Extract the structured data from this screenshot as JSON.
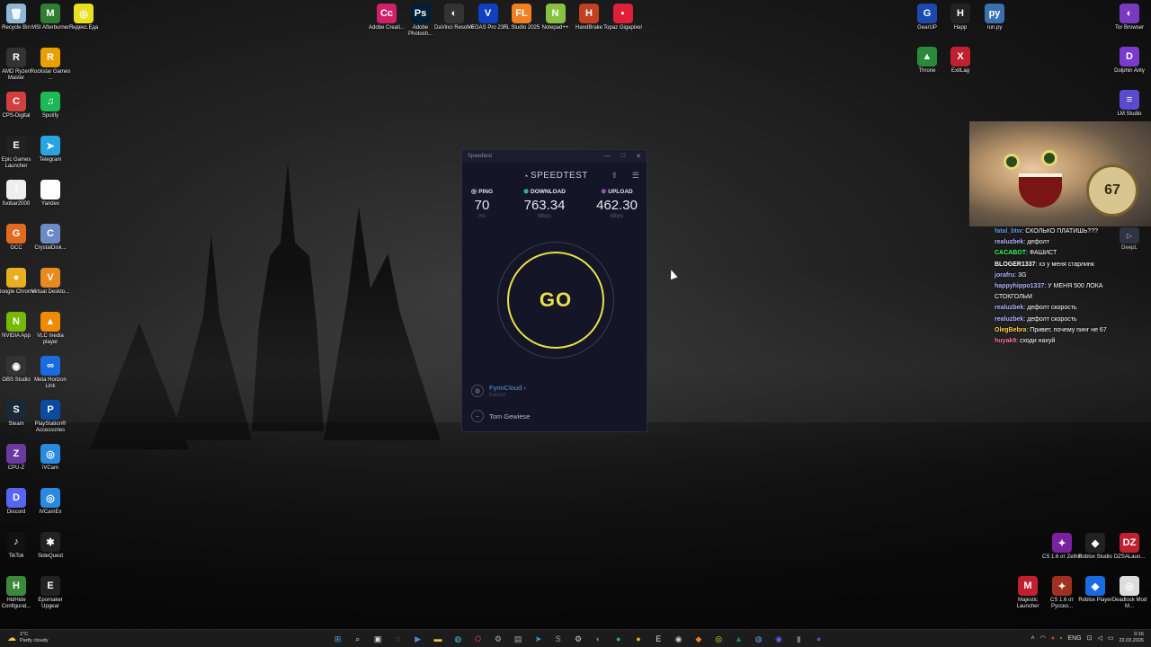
{
  "desktop": {
    "left_column_1": [
      {
        "label": "Recycle Bin",
        "icon": "recycle-bin-icon",
        "color": "#8fb8d8",
        "glyph": "🗑"
      },
      {
        "label": "AMD Ryzen Master",
        "icon": "amd-icon",
        "color": "#333",
        "glyph": "R"
      },
      {
        "label": "CPS-Digital",
        "icon": "cps-icon",
        "color": "#d04040",
        "glyph": "C"
      },
      {
        "label": "Epic Games Launcher",
        "icon": "epic-games-icon",
        "color": "#222",
        "glyph": "E"
      },
      {
        "label": "foobar2000",
        "icon": "foobar-icon",
        "color": "#eee",
        "glyph": "f"
      },
      {
        "label": "GCC",
        "icon": "gcc-icon",
        "color": "#e06a20",
        "glyph": "G"
      },
      {
        "label": "Google Chrome",
        "icon": "chrome-icon",
        "color": "#e8b020",
        "glyph": "●"
      },
      {
        "label": "NVIDIA App",
        "icon": "nvidia-icon",
        "color": "#76b900",
        "glyph": "N"
      },
      {
        "label": "OBS Studio",
        "icon": "obs-icon",
        "color": "#333",
        "glyph": "◉"
      },
      {
        "label": "Steam",
        "icon": "steam-icon",
        "color": "#1b2838",
        "glyph": "S"
      },
      {
        "label": "CPU-Z",
        "icon": "cpuz-icon",
        "color": "#6a3aa0",
        "glyph": "Z"
      },
      {
        "label": "Discord",
        "icon": "discord-icon",
        "color": "#5865f2",
        "glyph": "D"
      },
      {
        "label": "TikTok",
        "icon": "tiktok-icon",
        "color": "#111",
        "glyph": "♪"
      },
      {
        "label": "HidHide Configurat...",
        "icon": "hidhide-icon",
        "color": "#3a8a3a",
        "glyph": "H"
      }
    ],
    "left_column_2": [
      {
        "label": "MSI Afterburner",
        "icon": "msi-afterburner-icon",
        "color": "#2e7d32",
        "glyph": "M"
      },
      {
        "label": "Rockstar Games ...",
        "icon": "rockstar-icon",
        "color": "#e8a000",
        "glyph": "R"
      },
      {
        "label": "Spotify",
        "icon": "spotify-icon",
        "color": "#1db954",
        "glyph": "♫"
      },
      {
        "label": "Telegram",
        "icon": "telegram-icon",
        "color": "#2aa3e0",
        "glyph": "➤"
      },
      {
        "label": "Yandex",
        "icon": "yandex-icon",
        "color": "#fff",
        "glyph": "Y"
      },
      {
        "label": "CrystalDisk...",
        "icon": "crystaldisk-icon",
        "color": "#6a8ac8",
        "glyph": "C"
      },
      {
        "label": "Virtual Deskto...",
        "icon": "virtual-desktop-icon",
        "color": "#e88a20",
        "glyph": "V"
      },
      {
        "label": "VLC media player",
        "icon": "vlc-icon",
        "color": "#f08a00",
        "glyph": "▲"
      },
      {
        "label": "Meta Horizon Link",
        "icon": "meta-icon",
        "color": "#1a6ae0",
        "glyph": "∞"
      },
      {
        "label": "PlayStation® Accessories",
        "icon": "playstation-icon",
        "color": "#0a4aa0",
        "glyph": "P"
      },
      {
        "label": "iVCam",
        "icon": "ivcam-icon",
        "color": "#2a8ae0",
        "glyph": "◎"
      },
      {
        "label": "iVCamEx",
        "icon": "ivcamex-icon",
        "color": "#2a8ae0",
        "glyph": "◎"
      },
      {
        "label": "SideQuest",
        "icon": "sidequest-icon",
        "color": "#222",
        "glyph": "✱"
      },
      {
        "label": "Epomaker Upgear",
        "icon": "epomaker-icon",
        "color": "#222",
        "glyph": "E"
      }
    ],
    "third_item": {
      "label": "Яндекс.Еда",
      "icon": "yandex-eda-icon",
      "color": "#e8e020",
      "glyph": "◎"
    },
    "top_row": [
      {
        "label": "Adobe Creati...",
        "icon": "adobe-cc-icon",
        "color": "#d0206a",
        "glyph": "Cc"
      },
      {
        "label": "Adobe Photosh...",
        "icon": "photoshop-icon",
        "color": "#001e36",
        "glyph": "Ps"
      },
      {
        "label": "DaVinci Resolve",
        "icon": "davinci-icon",
        "color": "#333",
        "glyph": "◐"
      },
      {
        "label": "VEGAS Pro 23.0",
        "icon": "vegas-icon",
        "color": "#1040c0",
        "glyph": "V"
      },
      {
        "label": "FL Studio 2025",
        "icon": "fl-studio-icon",
        "color": "#f08020",
        "glyph": "FL"
      },
      {
        "label": "Notepad++",
        "icon": "notepadpp-icon",
        "color": "#8ac040",
        "glyph": "N"
      },
      {
        "label": "HandBrake",
        "icon": "handbrake-icon",
        "color": "#c04020",
        "glyph": "H"
      },
      {
        "label": "Topaz Gigapixel",
        "icon": "topaz-icon",
        "color": "#e0203a",
        "glyph": "▪"
      }
    ],
    "right_top": [
      {
        "label": "GearUP",
        "icon": "gearup-icon",
        "color": "#1a4ab0",
        "glyph": "G"
      },
      {
        "label": "Happ",
        "icon": "happ-icon",
        "color": "#222",
        "glyph": "H"
      },
      {
        "label": "run.py",
        "icon": "python-file-icon",
        "color": "#3a70b0",
        "glyph": "py"
      },
      {
        "label": "Tor Browser",
        "icon": "tor-icon",
        "color": "#7a3ac0",
        "glyph": "◐"
      }
    ],
    "right_second": [
      {
        "label": "Throne",
        "icon": "throne-icon",
        "color": "#2a8a3a",
        "glyph": "▲"
      },
      {
        "label": "ExitLag",
        "icon": "exitlag-icon",
        "color": "#c02030",
        "glyph": "X"
      },
      {
        "label": "Dolphin Anty",
        "icon": "dolphin-icon",
        "color": "#7a3ad0",
        "glyph": "D"
      }
    ],
    "lm_studio": {
      "label": "LM Studio",
      "icon": "lm-studio-icon",
      "color": "#5a4ad0",
      "glyph": "≡"
    },
    "bottom_right_1": [
      {
        "label": "CS 1.6 от Zethis",
        "icon": "cs-icon",
        "color": "#7a20a0",
        "glyph": "✦"
      },
      {
        "label": "Roblox Studio",
        "icon": "roblox-studio-icon",
        "color": "#222",
        "glyph": "◆"
      },
      {
        "label": "DZSALaun...",
        "icon": "dzsa-icon",
        "color": "#c02030",
        "glyph": "DZ"
      }
    ],
    "bottom_right_2": [
      {
        "label": "Majestic Launcher",
        "icon": "majestic-icon",
        "color": "#c02030",
        "glyph": "M"
      },
      {
        "label": "CS 1.6 от Русско...",
        "icon": "cs-ru-icon",
        "color": "#a03020",
        "glyph": "✦"
      },
      {
        "label": "Roblox Player",
        "icon": "roblox-player-icon",
        "color": "#1a6ae0",
        "glyph": "◆"
      },
      {
        "label": "Deadlock Mod M...",
        "icon": "deadlock-icon",
        "color": "#ddd",
        "glyph": "◎"
      }
    ]
  },
  "speedtest": {
    "window_title": "Speedtest",
    "brand": "SPEEDTEST",
    "ping": {
      "label": "PING",
      "value": "70",
      "unit": "ms"
    },
    "download": {
      "label": "DOWNLOAD",
      "value": "763.34",
      "unit": "Mbps"
    },
    "upload": {
      "label": "UPLOAD",
      "value": "462.30",
      "unit": "Mbps"
    },
    "go_label": "GO",
    "server_name": "FynnCloud",
    "server_location": "Kassel",
    "user_name": "Tom Gewiese",
    "colors": {
      "accent": "#e8e24a",
      "background": "#141526",
      "link": "#5a9bd8"
    }
  },
  "stream": {
    "chat": [
      {
        "user": "fatal_btw",
        "color": "#5a9bd8",
        "msg": "СКОЛЬКО ПЛАТИШЬ???"
      },
      {
        "user": "realuzbek",
        "color": "#b0b0ff",
        "msg": "дефолт"
      },
      {
        "user": "CACABOT",
        "color": "#3aff5a",
        "msg": "ФАШИСТ"
      },
      {
        "user": "BLOGER1337",
        "color": "#ffffff",
        "msg": "хз у меня старлинк"
      },
      {
        "user": "jorafru",
        "color": "#b0b0ff",
        "msg": "3G"
      },
      {
        "user": "happyhippo1337",
        "color": "#b0b0ff",
        "msg": "У МЕНЯ 500 ЛОКА СТОКГОЛЬМ"
      },
      {
        "user": "realuzbek",
        "color": "#b0b0ff",
        "msg": "дефолт скорость"
      },
      {
        "user": "realuzbek",
        "color": "#b0b0ff",
        "msg": "дефолт скорость"
      },
      {
        "user": "OlegBebra",
        "color": "#ffd040",
        "msg": "Привет, почему пинг не 67"
      },
      {
        "user": "huyak9",
        "color": "#ff70a0",
        "msg": "сходи нахуй"
      }
    ],
    "cam_clock_text": "67",
    "deepl_label": "DeepL"
  },
  "taskbar": {
    "weather_temp": "1°C",
    "weather_desc": "Partly cloudy",
    "lang": "ENG",
    "time": "0:16",
    "date": "22.03.2026",
    "apps": [
      {
        "icon": "start-icon",
        "glyph": "⊞",
        "color": "#4aa0f0"
      },
      {
        "icon": "search-icon",
        "glyph": "⌕",
        "color": "#ddd"
      },
      {
        "icon": "task-view-icon",
        "glyph": "▣",
        "color": "#ddd"
      },
      {
        "icon": "copilot-icon",
        "glyph": "◌",
        "color": "#9ad"
      },
      {
        "icon": "terminal-icon",
        "glyph": "▶",
        "color": "#4a8ae0"
      },
      {
        "icon": "explorer-icon",
        "glyph": "▬",
        "color": "#f0c040"
      },
      {
        "icon": "browser-app-icon",
        "glyph": "◍",
        "color": "#4ac0e0"
      },
      {
        "icon": "opera-icon",
        "glyph": "O",
        "color": "#e03030"
      },
      {
        "icon": "tool-icon",
        "glyph": "⚙",
        "color": "#aaa"
      },
      {
        "icon": "window-app-icon",
        "glyph": "▤",
        "color": "#aaa"
      },
      {
        "icon": "telegram-task-icon",
        "glyph": "➤",
        "color": "#2aa3e0"
      },
      {
        "icon": "steam-task-icon",
        "glyph": "S",
        "color": "#8ab"
      },
      {
        "icon": "gear-task-icon",
        "glyph": "⚙",
        "color": "#ccc"
      },
      {
        "icon": "tor-task-icon",
        "glyph": "◐",
        "color": "#9a6ad0"
      },
      {
        "icon": "spotify-task-icon",
        "glyph": "●",
        "color": "#1db954"
      },
      {
        "icon": "chrome-task-icon",
        "glyph": "●",
        "color": "#e8b020"
      },
      {
        "icon": "epic-task-icon",
        "glyph": "E",
        "color": "#ddd"
      },
      {
        "icon": "obs-task-icon",
        "glyph": "◉",
        "color": "#ccc"
      },
      {
        "icon": "fl-task-icon",
        "glyph": "◆",
        "color": "#f08020"
      },
      {
        "icon": "yandex-task-icon",
        "glyph": "◎",
        "color": "#e8e020"
      },
      {
        "icon": "throne-task-icon",
        "glyph": "▲",
        "color": "#2a8a3a"
      },
      {
        "icon": "globe-task-icon",
        "glyph": "◍",
        "color": "#6aa0e0"
      },
      {
        "icon": "discord-task-icon",
        "glyph": "◉",
        "color": "#5865f2"
      },
      {
        "icon": "app-task-icon",
        "glyph": "▮",
        "color": "#777"
      },
      {
        "icon": "tor-browser-task-icon",
        "glyph": "●",
        "color": "#7a3ac0"
      }
    ]
  }
}
